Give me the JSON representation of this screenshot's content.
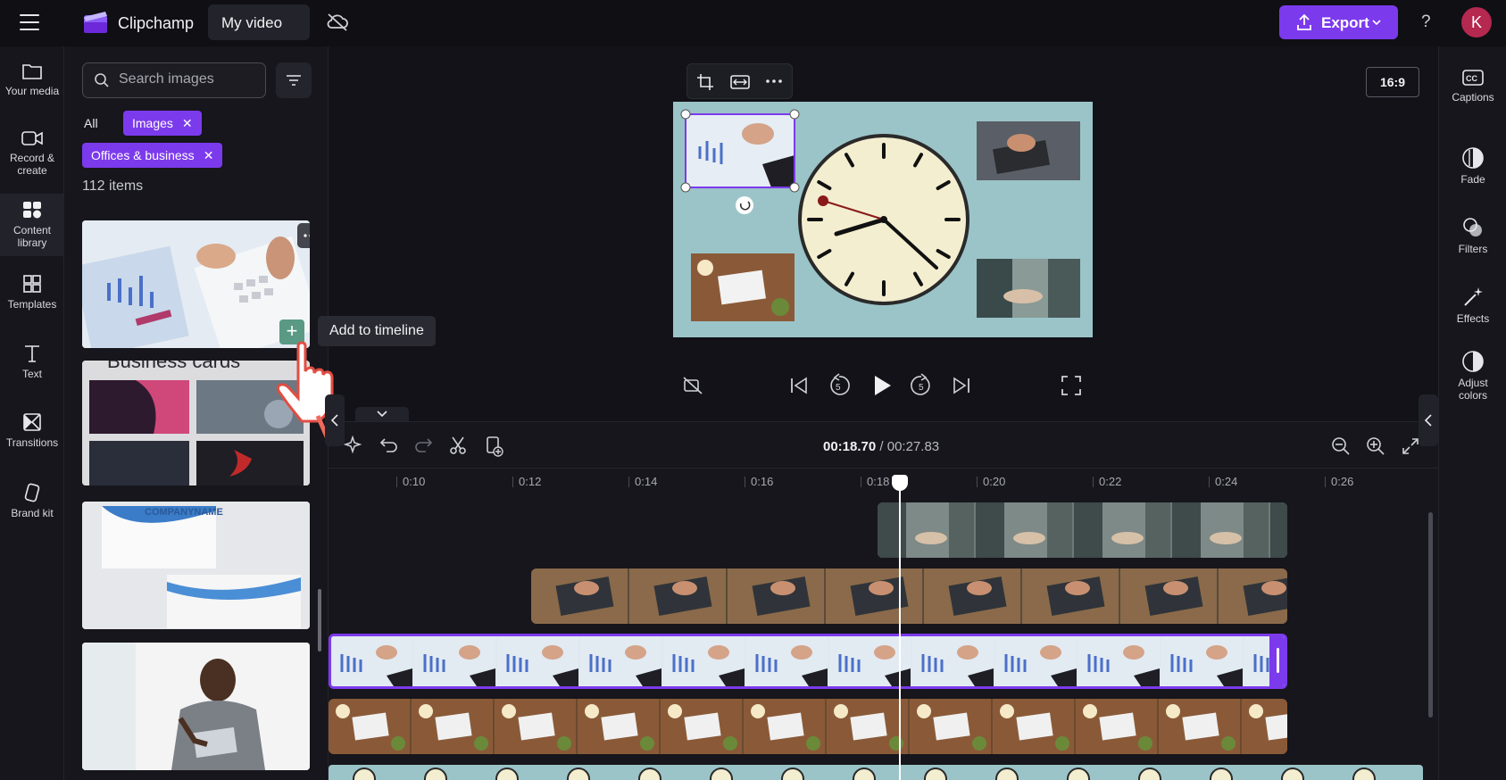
{
  "topbar": {
    "app_name": "Clipchamp",
    "project_title": "My video",
    "export_label": "Export",
    "help_label": "?",
    "avatar_initial": "K",
    "accent_color": "#7c3aed"
  },
  "leftnav": {
    "items": [
      {
        "label": "Your media",
        "icon": "folder-icon"
      },
      {
        "label": "Record & create",
        "icon": "camera-icon"
      },
      {
        "label": "Content library",
        "icon": "content-library-icon"
      },
      {
        "label": "Templates",
        "icon": "templates-icon"
      },
      {
        "label": "Text",
        "icon": "text-icon"
      },
      {
        "label": "Transitions",
        "icon": "transitions-icon"
      },
      {
        "label": "Brand kit",
        "icon": "brand-kit-icon"
      }
    ]
  },
  "media": {
    "search_placeholder": "Search images",
    "filter_all": "All",
    "chip_images": "Images",
    "chip_category": "Offices & business",
    "chip_close": "✕",
    "count": "112 items",
    "tooltip": "Add to timeline",
    "add_symbol": "+",
    "cards_text": "Business cards",
    "company_name": "COMPANYNAME"
  },
  "preview": {
    "ratio": "16:9"
  },
  "rightnav": {
    "items": [
      {
        "label": "Captions",
        "icon": "captions-icon"
      },
      {
        "label": "Fade",
        "icon": "fade-icon"
      },
      {
        "label": "Filters",
        "icon": "filters-icon"
      },
      {
        "label": "Effects",
        "icon": "effects-icon"
      },
      {
        "label": "Adjust colors",
        "icon": "adjust-colors-icon"
      }
    ]
  },
  "timeline": {
    "current_time": "00:18.70",
    "separator": " / ",
    "total_time": "00:27.83",
    "ruler": [
      "0:10",
      "0:12",
      "0:14",
      "0:16",
      "0:18",
      "0:20",
      "0:22",
      "0:24",
      "0:26"
    ]
  }
}
